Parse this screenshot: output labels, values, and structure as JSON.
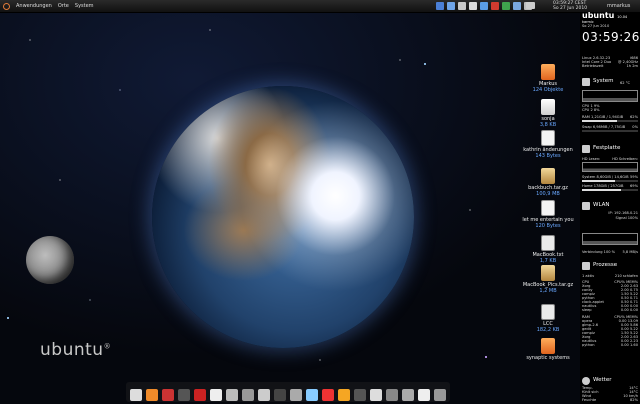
{
  "top_panel": {
    "menu": [
      "Anwendungen",
      "Orte",
      "System"
    ],
    "clock_time": "03:59:27 CEST",
    "clock_date": "So 27 Jun 2010",
    "user": "mmarkus"
  },
  "desktop": {
    "watermark": "ubuntu",
    "icons": [
      {
        "name": "Markus",
        "size": "124 Objekte",
        "type": "folder"
      },
      {
        "name": "sonja",
        "size": "3,8 KB",
        "type": "file"
      },
      {
        "name": "kathrin änderungen",
        "size": "143 Bytes",
        "type": "text"
      },
      {
        "name": "backbuch.tar.gz",
        "size": "100,9 MB",
        "type": "zip"
      },
      {
        "name": "let me entertain you",
        "size": "120 Bytes",
        "type": "text"
      },
      {
        "name": "MacBook.txt",
        "size": "1,7 KB",
        "type": "doc"
      },
      {
        "name": "MacBook_Pics.tar.gz",
        "size": "1,2 MB",
        "type": "zip"
      },
      {
        "name": "LCC",
        "size": "182,2 KB",
        "type": "doc"
      },
      {
        "name": "synaptic systems",
        "size": "",
        "type": "app"
      }
    ]
  },
  "conky": {
    "brand": "ubuntu",
    "brand_sub": "10.04 karmic",
    "date": "So 27 Jun 2010",
    "time": "03:59:26",
    "sysinfo": [
      [
        "Linux 2.6.32-23",
        "i686"
      ],
      [
        "Intel Core 2 Duo",
        "@ 2,40GHz"
      ],
      [
        "Betriebszeit",
        "1h 2m"
      ]
    ],
    "system": {
      "title": "System",
      "temp": "62 °C",
      "cpu1": "CPU 1  9%",
      "cpu2": "CPU 2  8%",
      "ram": [
        "RAM 1,21GiB / 1,94GiB",
        "62%"
      ],
      "ram_pct": 62,
      "swap": [
        "Swap 6,98MiB / 7,75GiB",
        "0%"
      ],
      "swap_pct": 0
    },
    "disk": {
      "title": "Festplatte",
      "read": "HD Lesen:",
      "write": "HD Schreiben:",
      "system": [
        "System 8,60GiB / 14,6GiB",
        "59%"
      ],
      "system_pct": 59,
      "home": [
        "Home 178GiB / 257GiB",
        "69%"
      ],
      "home_pct": 69
    },
    "wlan": {
      "title": "WLAN",
      "ip": "IP: 192.168.0.21",
      "signal": "Signal 100%",
      "connections": "Verbindung 100 %",
      "rate": "5,8 MB/s"
    },
    "procs": {
      "title": "Prozesse",
      "summary": [
        "1 aktiv",
        "210 schlafen"
      ],
      "cpu_header": [
        "CPU",
        "CPU% MEM%"
      ],
      "cpu_list": [
        [
          "Xorg",
          "2.00 2.63"
        ],
        [
          "conky",
          "2.00 0.75"
        ],
        [
          "compiz",
          "1.50 5.22"
        ],
        [
          "python",
          "0.50 0.71"
        ],
        [
          "clock-applet",
          "0.50 0.71"
        ],
        [
          "nautilus",
          "0.00 0.00"
        ],
        [
          "sleep",
          "0.00 0.00"
        ]
      ],
      "mem_header": [
        "RAM",
        "CPU% MEM%"
      ],
      "mem_list": [
        [
          "opera",
          "0.00 13.09"
        ],
        [
          "gimp-2.6",
          "0.00 5.86"
        ],
        [
          "gedit",
          "0.00 5.22"
        ],
        [
          "compiz",
          "1.50 5.22"
        ],
        [
          "Xorg",
          "2.00 2.63"
        ],
        [
          "nautilus",
          "0.00 2.23"
        ],
        [
          "python",
          "0.00 1.60"
        ]
      ]
    },
    "weather": {
      "title": "Wetter",
      "temp_label": "Temp.",
      "temp": "14°C",
      "feels_label": "fühlt sich",
      "feels": "14°C",
      "wind_label": "Wind",
      "wind": "10 km/h",
      "humidity_label": "Feuchte",
      "humidity": "82%"
    }
  },
  "dock_count": 20
}
